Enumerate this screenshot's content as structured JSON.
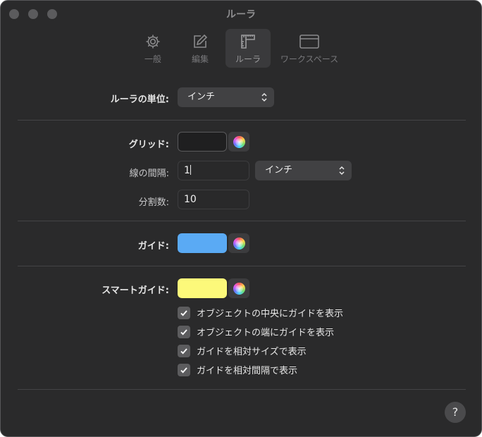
{
  "window": {
    "title": "ルーラ"
  },
  "toolbar": {
    "tabs": [
      {
        "label": "一般",
        "icon": "gear-icon"
      },
      {
        "label": "編集",
        "icon": "edit-icon"
      },
      {
        "label": "ルーラ",
        "icon": "ruler-icon",
        "selected": true
      },
      {
        "label": "ワークスペース",
        "icon": "window-icon"
      }
    ]
  },
  "units": {
    "label": "ルーラの単位:",
    "value": "インチ"
  },
  "grid": {
    "label": "グリッド:",
    "color": "#1f1f20",
    "spacing_label": "線の間隔:",
    "spacing_value": "1",
    "spacing_unit": "インチ",
    "subdivisions_label": "分割数:",
    "subdivisions_value": "10"
  },
  "guides": {
    "label": "ガイド:",
    "color": "#5aaaf4"
  },
  "smart_guides": {
    "label": "スマートガイド:",
    "color": "#fcf97a",
    "options": [
      {
        "label": "オブジェクトの中央にガイドを表示",
        "checked": true
      },
      {
        "label": "オブジェクトの端にガイドを表示",
        "checked": true
      },
      {
        "label": "ガイドを相対サイズで表示",
        "checked": true
      },
      {
        "label": "ガイドを相対間隔で表示",
        "checked": true
      }
    ]
  },
  "help": {
    "label": "?"
  }
}
